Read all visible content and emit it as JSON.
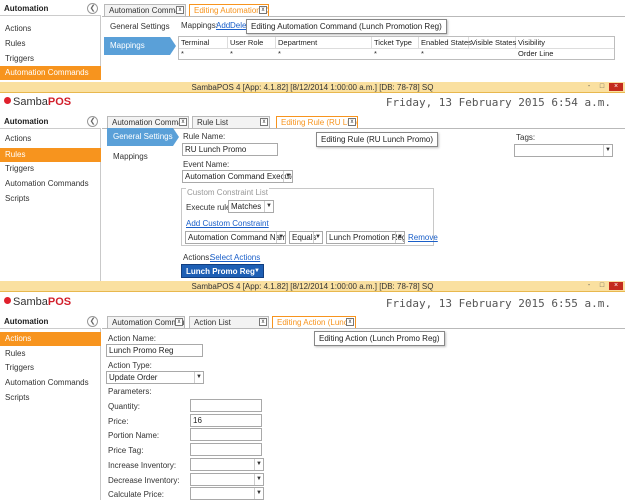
{
  "panel1": {
    "sidebar": {
      "header": "Automation",
      "back_icon": "circle-arrow-left-icon",
      "items": [
        {
          "label": "Actions"
        },
        {
          "label": "Rules"
        },
        {
          "label": "Triggers"
        },
        {
          "label": "Automation Commands",
          "active": true
        }
      ]
    },
    "tabs": [
      {
        "label": "Automation Comman",
        "close": "x"
      },
      {
        "label": "Editing Automation C",
        "close": "x",
        "active": true
      }
    ],
    "nav": {
      "general": "General Settings",
      "mappings": "Mappings"
    },
    "mappings_label": "Mappings:",
    "add_link": "Add",
    "delete_link": "Delet",
    "tooltip": "Editing Automation Command (Lunch Promotion Reg)",
    "grid": {
      "columns": [
        "Terminal",
        "User Role",
        "Department",
        "Ticket Type",
        "Enabled States",
        "Visible States",
        "Visibility"
      ],
      "row": [
        "*",
        "*",
        "*",
        "*",
        "*",
        "",
        "Order Line"
      ]
    }
  },
  "panel2": {
    "title": "SambaPOS 4 [App: 4.1.82] [8/12/2014 1:00:00 a.m.] [DB: 78-78] SQ",
    "logo": {
      "prefix": "Samba",
      "suffix": "POS"
    },
    "clock": "Friday, 13 February 2015 6:54 a.m.",
    "sidebar": {
      "header": "Automation",
      "items": [
        {
          "label": "Actions"
        },
        {
          "label": "Rules",
          "active": true
        },
        {
          "label": "Triggers"
        },
        {
          "label": "Automation Commands"
        },
        {
          "label": "Scripts"
        }
      ]
    },
    "tabs": [
      {
        "label": "Automation Comman",
        "close": "x"
      },
      {
        "label": "Rule List",
        "close": "x"
      },
      {
        "label": "Editing Rule (RU Lunc",
        "close": "x",
        "active": true
      }
    ],
    "nav": {
      "general": "General Settings",
      "mappings": "Mappings"
    },
    "rule_name_label": "Rule Name:",
    "rule_name_value": "RU Lunch Promo",
    "tooltip": "Editing Rule (RU Lunch Promo)",
    "tags_label": "Tags:",
    "event_name_label": "Event Name:",
    "event_name_value": "Automation Command Executed",
    "constraint_group": "Custom Constraint List",
    "execute_label": "Execute rule if",
    "execute_value": "Matches",
    "add_constraint": "Add Custom Constraint",
    "constraint": {
      "field": "Automation Command Name",
      "op": "Equals",
      "value": "Lunch Promotion Reg",
      "remove": "Remove"
    },
    "actions_label": "Actions:",
    "select_actions": "Select Actions",
    "action_selected": "Lunch Promo Reg"
  },
  "panel3": {
    "title": "SambaPOS 4 [App: 4.1.82] [8/12/2014 1:00:00 a.m.] [DB: 78-78] SQ",
    "logo": {
      "prefix": "Samba",
      "suffix": "POS"
    },
    "clock": "Friday, 13 February 2015 6:55 a.m.",
    "sidebar": {
      "header": "Automation",
      "items": [
        {
          "label": "Actions",
          "active": true
        },
        {
          "label": "Rules"
        },
        {
          "label": "Triggers"
        },
        {
          "label": "Automation Commands"
        },
        {
          "label": "Scripts"
        }
      ]
    },
    "tabs": [
      {
        "label": "Automation Comman",
        "close": "x"
      },
      {
        "label": "Action List",
        "close": "x"
      },
      {
        "label": "Editing Action (Lunch",
        "close": "x",
        "active": true
      }
    ],
    "action_name_label": "Action Name:",
    "action_name_value": "Lunch Promo Reg",
    "tooltip": "Editing Action (Lunch Promo Reg)",
    "action_type_label": "Action Type:",
    "action_type_value": "Update Order",
    "parameters_label": "Parameters:",
    "params": [
      {
        "label": "Quantity:",
        "value": "",
        "kind": "input"
      },
      {
        "label": "Price:",
        "value": "16",
        "kind": "input"
      },
      {
        "label": "Portion Name:",
        "value": "",
        "kind": "input"
      },
      {
        "label": "Price Tag:",
        "value": "",
        "kind": "input"
      },
      {
        "label": "Increase Inventory:",
        "value": "",
        "kind": "select"
      },
      {
        "label": "Decrease Inventory:",
        "value": "",
        "kind": "select"
      },
      {
        "label": "Calculate Price:",
        "value": "",
        "kind": "select"
      }
    ]
  },
  "window_controls": {
    "minimize": "-",
    "maximize": "□",
    "close": "×"
  },
  "colors": {
    "accent_orange": "#f7941e",
    "nav_blue": "#5aa0d8",
    "title_bar": "#fae0a0",
    "action_button": "#1e5fb4",
    "link": "#1a5fc9"
  }
}
